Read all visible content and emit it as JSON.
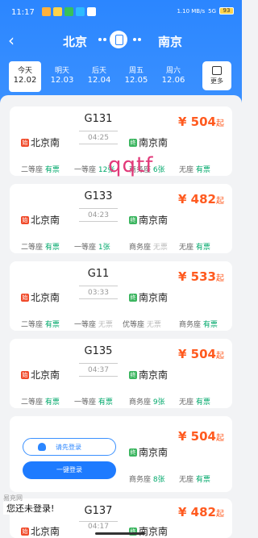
{
  "status": {
    "time": "11:17",
    "net": "1.10 MB/s",
    "signal": "5G",
    "battery": "93"
  },
  "route": {
    "from": "北京",
    "to": "南京"
  },
  "dates": [
    {
      "day": "今天",
      "date": "12.02",
      "active": true
    },
    {
      "day": "明天",
      "date": "12.03"
    },
    {
      "day": "后天",
      "date": "12.04"
    },
    {
      "day": "周五",
      "date": "12.05"
    },
    {
      "day": "周六",
      "date": "12.06"
    }
  ],
  "more_label": "更多",
  "trains": [
    {
      "no": "G131",
      "dur": "04:25",
      "from": "北京南",
      "to": "南京南",
      "price": "¥ 504",
      "price_suffix": "起",
      "seats": [
        {
          "t": "二等座",
          "s": "有票"
        },
        {
          "t": "一等座",
          "s": "12张"
        },
        {
          "t": "商务座",
          "s": "6张"
        },
        {
          "t": "无座",
          "s": "有票"
        }
      ]
    },
    {
      "no": "G133",
      "dur": "04:23",
      "from": "北京南",
      "to": "南京南",
      "price": "¥ 482",
      "price_suffix": "起",
      "seats": [
        {
          "t": "二等座",
          "s": "有票"
        },
        {
          "t": "一等座",
          "s": "1张"
        },
        {
          "t": "商务座",
          "s": "无票"
        },
        {
          "t": "无座",
          "s": "有票"
        }
      ]
    },
    {
      "no": "G11",
      "dur": "03:33",
      "from": "北京南",
      "to": "南京南",
      "price": "¥ 533",
      "price_suffix": "起",
      "seats": [
        {
          "t": "二等座",
          "s": "有票"
        },
        {
          "t": "一等座",
          "s": "无票"
        },
        {
          "t": "优等座",
          "s": "无票"
        },
        {
          "t": "商务座",
          "s": "有票"
        }
      ]
    },
    {
      "no": "G135",
      "dur": "04:37",
      "from": "北京南",
      "to": "南京南",
      "price": "¥ 504",
      "price_suffix": "起",
      "seats": [
        {
          "t": "二等座",
          "s": "有票"
        },
        {
          "t": "一等座",
          "s": "有票"
        },
        {
          "t": "商务座",
          "s": "9张"
        },
        {
          "t": "无座",
          "s": "有票"
        }
      ]
    },
    {
      "no": "",
      "dur": "",
      "from": "",
      "to": "南京南",
      "price": "¥ 504",
      "price_suffix": "起",
      "seats": [
        {
          "t": "",
          "s": ""
        },
        {
          "t": "",
          "s": ""
        },
        {
          "t": "商务座",
          "s": "8张"
        },
        {
          "t": "无座",
          "s": "有票"
        }
      ]
    },
    {
      "no": "G137",
      "dur": "04:17",
      "from": "北京南",
      "to": "南京南",
      "price": "¥ 482",
      "price_suffix": "起",
      "seats": []
    }
  ],
  "watermark": "qqtf",
  "login": {
    "prompt": "请先登录",
    "quick": "一键登录",
    "ad_text": "易充网",
    "not_logged": "您还未登录!"
  },
  "tags": {
    "start": "始",
    "end": "终"
  }
}
